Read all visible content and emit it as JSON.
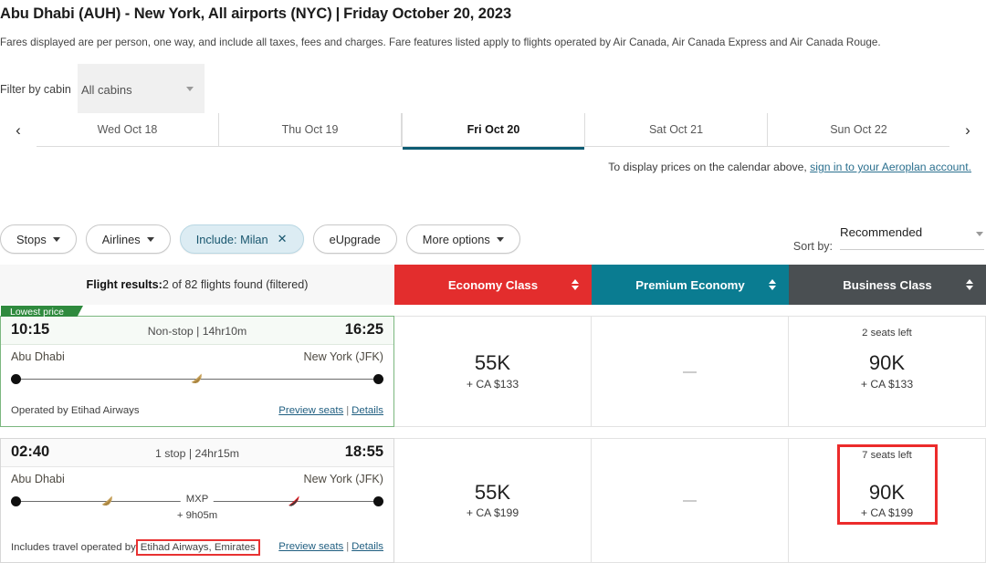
{
  "header": {
    "origin": "Abu Dhabi (AUH)",
    "dash": " - ",
    "destination": "New York, All airports (NYC)",
    "separator": "|",
    "date": "Friday October 20, 2023",
    "fares_note": "Fares displayed are per person, one way, and include all taxes, fees and charges. Fare features listed apply to flights operated by Air Canada, Air Canada Express and Air Canada Rouge."
  },
  "cabin_filter": {
    "label": "Filter by cabin",
    "value": "All cabins",
    "caret_icon": "chevron-down-icon"
  },
  "date_tabs": {
    "prev_icon": "chevron-left-icon",
    "next_icon": "chevron-right-icon",
    "items": [
      {
        "label": "Wed Oct 18",
        "active": false
      },
      {
        "label": "Thu Oct 19",
        "active": false
      },
      {
        "label": "Fri Oct 20",
        "active": true
      },
      {
        "label": "Sat Oct 21",
        "active": false
      },
      {
        "label": "Sun Oct 22",
        "active": false
      }
    ]
  },
  "signin_note": {
    "text": "To display prices on the calendar above, ",
    "link": "sign in to your Aeroplan account."
  },
  "filters": {
    "stops": "Stops",
    "airlines": "Airlines",
    "include": "Include: Milan",
    "include_close_icon": "close-icon",
    "eupgrade": "eUpgrade",
    "more_options": "More options"
  },
  "sort": {
    "label": "Sort by:",
    "value": "Recommended",
    "caret_icon": "chevron-down-icon"
  },
  "table": {
    "results_label": "Flight results:",
    "results_count": " 2 of 82 flights found (filtered)",
    "columns": [
      {
        "label": "Economy Class",
        "color": "#e32d2d"
      },
      {
        "label": "Premium Economy",
        "color": "#0a7c91"
      },
      {
        "label": "Business Class",
        "color": "#4a4f52"
      }
    ],
    "sort_icon": "sort-updown-icon"
  },
  "flights": [
    {
      "badge": "Lowest price",
      "depart_time": "10:15",
      "arrive_time": "16:25",
      "duration": "Non-stop | 14hr10m",
      "from_city": "Abu Dhabi",
      "to_city": "New York (JFK)",
      "stop_code": "",
      "layover": "",
      "operated_prefix": "Operated by Etihad Airways",
      "operated_highlight": "",
      "preview_seats": "Preview seats",
      "link_sep": "|",
      "details": "Details",
      "prices": [
        {
          "seats": "",
          "miles": "55K",
          "cash": "+ CA $133",
          "empty": false,
          "highlight": false
        },
        {
          "seats": "",
          "miles": "",
          "cash": "",
          "empty": true,
          "highlight": false
        },
        {
          "seats": "2 seats left",
          "miles": "90K",
          "cash": "+ CA $133",
          "empty": false,
          "highlight": false
        }
      ]
    },
    {
      "badge": "",
      "depart_time": "02:40",
      "arrive_time": "18:55",
      "duration": "1 stop | 24hr15m",
      "from_city": "Abu Dhabi",
      "to_city": "New York (JFK)",
      "stop_code": "MXP",
      "layover": "+ 9h05m",
      "operated_prefix": "Includes travel operated by",
      "operated_highlight": "Etihad Airways, Emirates",
      "preview_seats": "Preview seats",
      "link_sep": "|",
      "details": "Details",
      "prices": [
        {
          "seats": "",
          "miles": "55K",
          "cash": "+ CA $199",
          "empty": false,
          "highlight": false
        },
        {
          "seats": "",
          "miles": "",
          "cash": "",
          "empty": true,
          "highlight": false
        },
        {
          "seats": "7 seats left",
          "miles": "90K",
          "cash": "+ CA $199",
          "empty": false,
          "highlight": true
        }
      ]
    }
  ],
  "icons": {
    "airline_etihad": "etihad-plane-icon",
    "airline_emirates": "emirates-plane-icon"
  },
  "colors": {
    "economy": "#e32d2d",
    "premium": "#0a7c91",
    "business": "#4a4f52",
    "active_tab": "#0d5c73",
    "lowest_badge": "#2f8a3e",
    "highlight_red": "#ec2b2b",
    "chip_selected_bg": "#dcecf3",
    "link": "#1f5e80"
  }
}
